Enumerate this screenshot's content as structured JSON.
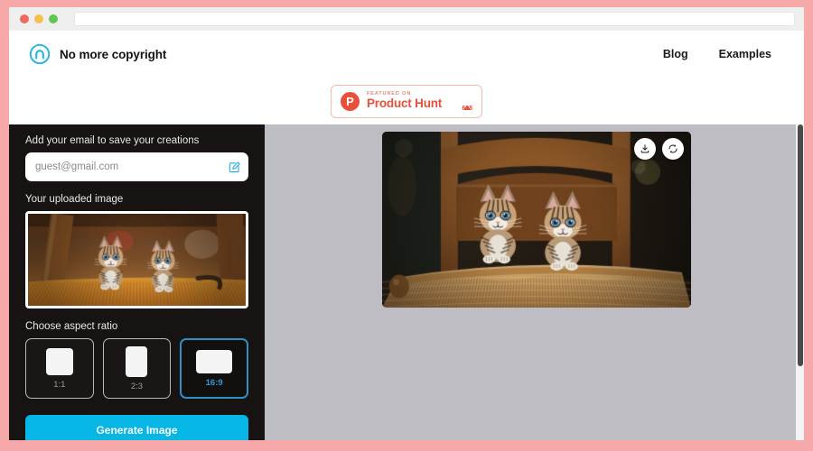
{
  "frame": {
    "accent_pink": "#f7a9a9"
  },
  "browser": {
    "traffic_lights": [
      "red",
      "yellow",
      "green"
    ],
    "address_value": "",
    "address_placeholder": ""
  },
  "header": {
    "brand_name": "No more copyright",
    "logo_icon": "circle-arch-logo-icon",
    "nav": [
      {
        "label": "Blog"
      },
      {
        "label": "Examples"
      }
    ]
  },
  "product_hunt": {
    "mark_letter": "P",
    "featured_label": "FEATURED ON",
    "product_label": "Product Hunt",
    "upvote_icon": "caret-up-icon",
    "vote_count": "608",
    "accent": "#e8503a"
  },
  "sidebar": {
    "background": "#171313",
    "email_section": {
      "label": "Add your email to save your creations",
      "value": "",
      "placeholder": "guest@gmail.com",
      "edit_icon": "edit-pencil-icon"
    },
    "upload_section": {
      "label": "Your uploaded image",
      "alt": "Two tabby kittens resting under a wooden chair on an orange woven seat"
    },
    "aspect_section": {
      "label": "Choose aspect ratio",
      "options": [
        {
          "label": "1:1",
          "selected": false
        },
        {
          "label": "2:3",
          "selected": false
        },
        {
          "label": "16:9",
          "selected": true
        }
      ],
      "selected_color": "#2f9ad4"
    },
    "generate_button": {
      "label": "Generate Image",
      "color": "#06b6e4"
    }
  },
  "canvas": {
    "background": "#bdbdc3",
    "result": {
      "alt": "Two AI-generated tabby kittens sitting on a woven wicker chair seat with a wooden chair back",
      "actions": [
        {
          "name": "download",
          "icon": "download-icon"
        },
        {
          "name": "regenerate",
          "icon": "refresh-icon"
        }
      ]
    }
  }
}
